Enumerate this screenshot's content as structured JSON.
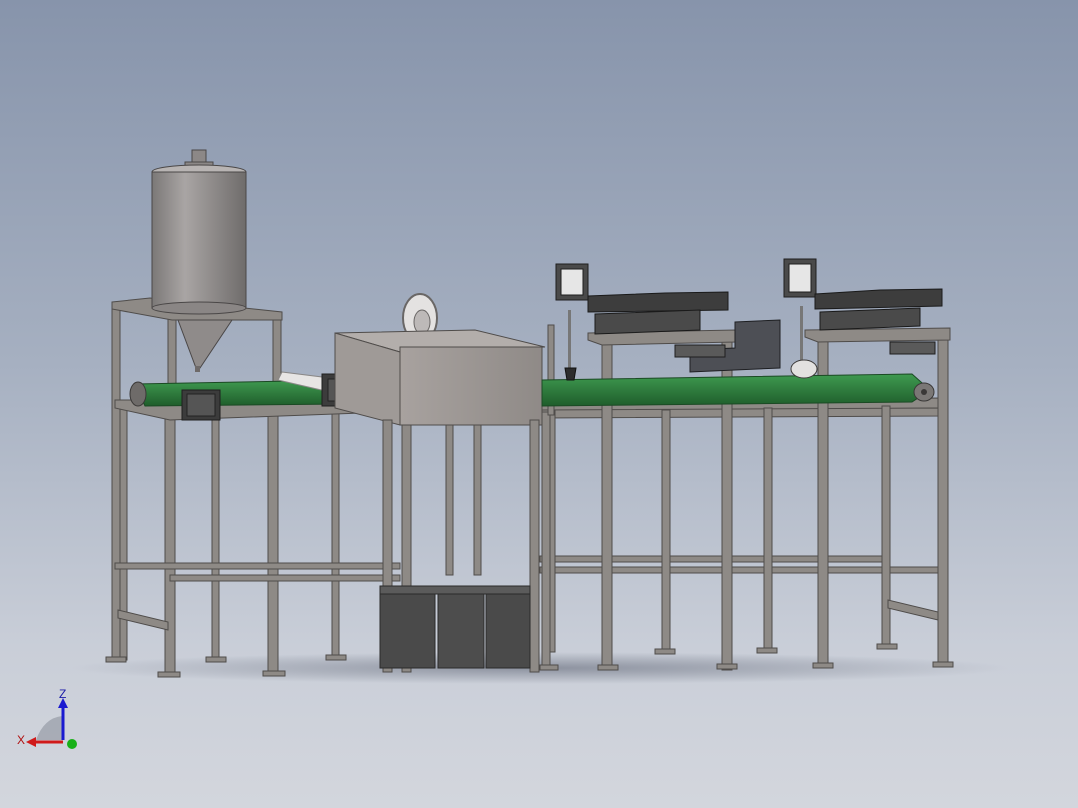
{
  "viewport": {
    "background_top": "#8794ab",
    "background_bottom": "#d3d6dd"
  },
  "model": {
    "frame_color": "#8e8a86",
    "frame_shadow": "#5f5c59",
    "belt_color": "#2f7d3e",
    "hopper_color": "#9a9594",
    "motor_color": "#3c3c3c",
    "bin_color": "#4a4a4a"
  },
  "triad": {
    "z_label": "Z",
    "x_label": "X",
    "x_color": "#d01a1a",
    "y_color": "#18b018",
    "z_color": "#1a1ad0"
  }
}
